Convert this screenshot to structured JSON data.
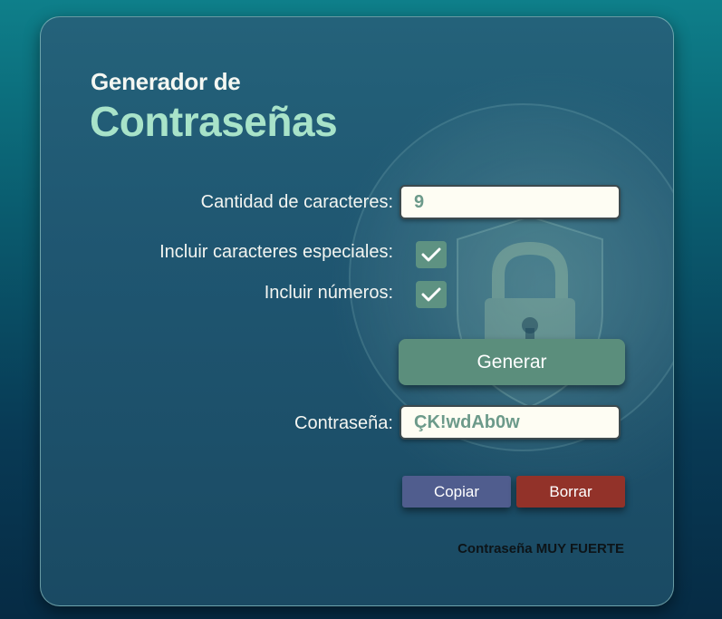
{
  "app": {
    "title_line1": "Generador de",
    "title_line2": "Contraseñas"
  },
  "form": {
    "length_label": "Cantidad de caracteres:",
    "length_value": "9",
    "special_chars_label": "Incluir caracteres especiales:",
    "special_chars_checked": true,
    "numbers_label": "Incluir números:",
    "numbers_checked": true,
    "generate_label": "Generar",
    "password_label": "Contraseña:",
    "password_value": "ÇK!wdAb0w"
  },
  "actions": {
    "copy_label": "Copiar",
    "clear_label": "Borrar"
  },
  "status": {
    "strength_text": "Contraseña MUY FUERTE"
  },
  "colors": {
    "accent_title": "#a8e3c9",
    "generate_button": "#5b8e7c",
    "copy_button": "#505d8e",
    "clear_button": "#923229",
    "checkbox": "#5e9282"
  },
  "icons": {
    "background": "padlock-shield-globe-icon",
    "checkmark": "checkmark-icon"
  }
}
